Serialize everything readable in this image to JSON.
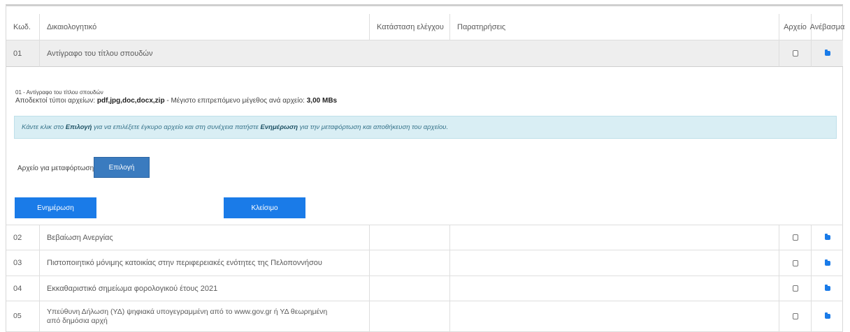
{
  "table": {
    "headers": [
      "Κωδ.",
      "Δικαιολογητικό",
      "Κατάσταση ελέγχου",
      "Παρατηρήσεις",
      "Αρχείο",
      "Ανέβασμα"
    ],
    "rows": [
      {
        "code": "01",
        "name": "Αντίγραφο του τίτλου σπουδών"
      },
      {
        "code": "02",
        "name": "Βεβαίωση Ανεργίας"
      },
      {
        "code": "03",
        "name": "Πιστοποιητικό μόνιμης κατοικίας στην περιφερειακές ενότητες της Πελοποννήσου"
      },
      {
        "code": "04",
        "name": "Εκκαθαριστικό σημείωμα φορολογικού έτους 2021"
      },
      {
        "code": "05",
        "name": "Υπεύθυνη Δήλωση (ΥΔ) ψηφιακά υπογεγραμμένη από το www.gov.gr ή ΥΔ θεωρημένη από δημόσια αρχή"
      }
    ]
  },
  "upload_panel": {
    "doc_title": "01 - Αντίγραφο του τίτλου σπουδών",
    "types_label": "Αποδεκτοί τύποι αρχείων:",
    "types_value": "pdf,jpg,doc,docx,zip",
    "size_label": "- Μέγιστο επιτρεπόμενο μέγεθος ανά αρχείο:",
    "size_value": "3,00 MBs",
    "info_1": "Κάντε κλικ στο",
    "info_select": "Επιλογή",
    "info_2": "για να επιλέξετε έγκυρο αρχείο και στη συνέχεια πατήστε",
    "info_update": "Ενημέρωση",
    "info_3": "για την μεταφόρτωση και αποθήκευση του αρχείου.",
    "file_label": "Αρχείο για μεταφόρτωση",
    "select_button": "Επιλογή",
    "update_button": "Ενημέρωση",
    "close_button": "Κλείσιμο"
  },
  "icons": {
    "file": "file-checkbox-icon",
    "upload": "folder-upload-icon"
  },
  "colors": {
    "primary_button": "#1a7be8",
    "select_button": "#3a7bbf",
    "info_background": "#d9eef4",
    "expanded_row": "#eeeeee"
  }
}
